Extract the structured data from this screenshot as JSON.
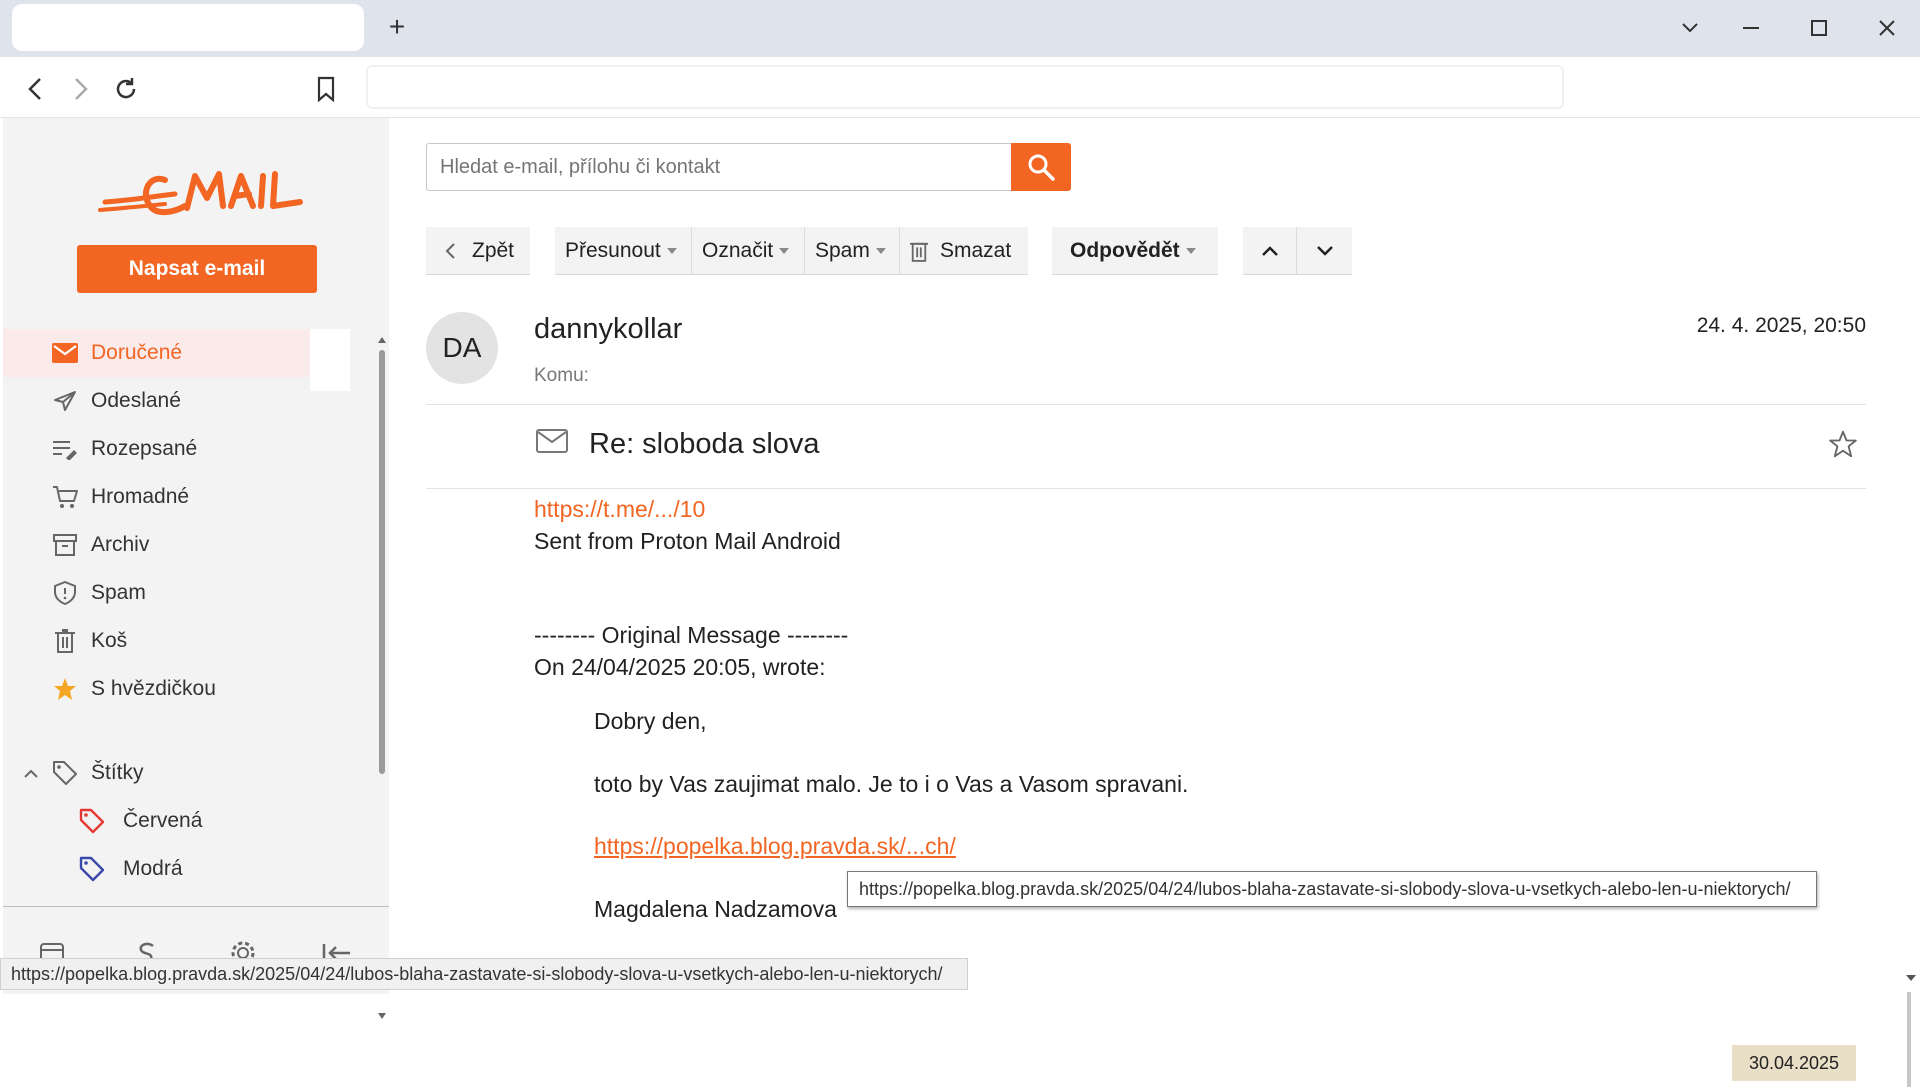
{
  "browser": {
    "new_tab_label": "+"
  },
  "sidebar": {
    "compose_label": "Napsat e-mail",
    "folders": [
      {
        "label": "Doručené"
      },
      {
        "label": "Odeslané"
      },
      {
        "label": "Rozepsané"
      },
      {
        "label": "Hromadné"
      },
      {
        "label": "Archiv"
      },
      {
        "label": "Spam"
      },
      {
        "label": "Koš"
      },
      {
        "label": "S hvězdičkou"
      }
    ],
    "labels_section": "Štítky",
    "labels": [
      {
        "label": "Červená",
        "color": "#e53935"
      },
      {
        "label": "Modrá",
        "color": "#3949ab"
      }
    ]
  },
  "search": {
    "placeholder": "Hledat e-mail, přílohu či kontakt"
  },
  "toolbar": {
    "back": "Zpět",
    "move": "Přesunout",
    "mark": "Označit",
    "spam": "Spam",
    "delete": "Smazat",
    "reply": "Odpovědět"
  },
  "message": {
    "avatar_initials": "DA",
    "sender": "dannykollar",
    "to_label": "Komu:",
    "date": "24. 4. 2025, 20:50",
    "subject": "Re: sloboda slova",
    "body": {
      "link1": "https://t.me/.../10",
      "line1": "Sent from Proton Mail Android",
      "original_header": "-------- Original Message --------",
      "original_meta": "On 24/04/2025 20:05, wrote:",
      "greeting": "Dobry den,",
      "para": "toto by Vas zaujimat malo. Je to i o Vas a Vasom spravani.",
      "link2": "https://popelka.blog.pravda.sk/...ch/",
      "signature": "Magdalena Nadzamova"
    }
  },
  "tooltip_url": "https://popelka.blog.pravda.sk/2025/04/24/lubos-blaha-zastavate-si-slobody-slova-u-vsetkych-alebo-len-u-niektorych/",
  "status_url": "https://popelka.blog.pravda.sk/2025/04/24/lubos-blaha-zastavate-si-slobody-slova-u-vsetkych-alebo-len-u-niektorych/",
  "taskbar_date": "30.04.2025",
  "colors": {
    "accent": "#f26522",
    "active_bg": "#fbeaea",
    "sidebar_bg": "#f3f3f3",
    "star": "#f5a623"
  }
}
